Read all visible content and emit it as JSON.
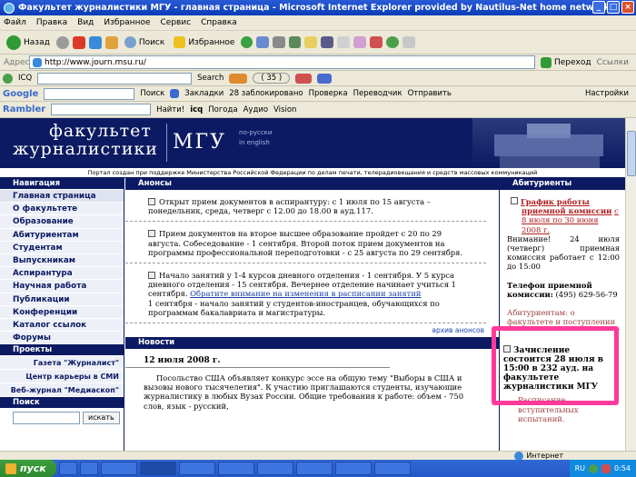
{
  "window": {
    "title": "Факультет журналистики МГУ - главная страница - Microsoft Internet Explorer provided by Nautilus-Net home network."
  },
  "menu": [
    "Файл",
    "Правка",
    "Вид",
    "Избранное",
    "Сервис",
    "Справка"
  ],
  "toolbar": {
    "back": "Назад",
    "search": "Поиск",
    "favorites": "Избранное"
  },
  "address": {
    "label": "Адрес",
    "url": "http://www.journ.msu.ru/",
    "go": "Переход",
    "links": "Ссылки"
  },
  "icq_bar": {
    "label": "ICQ",
    "search": "Search",
    "count": "( 35 )"
  },
  "google_bar": {
    "label": "Google",
    "search": "Поиск",
    "bookmarks": "Закладки",
    "blocked": "28 заблокировано",
    "check": "Проверка",
    "translate": "Переводчик",
    "send": "Отправить",
    "settings": "Настройки"
  },
  "rambler_bar": {
    "label": "Rambler",
    "find": "Найти!",
    "icq": "icq",
    "weather": "Погода",
    "audio": "Аудио",
    "vision": "Vision"
  },
  "site": {
    "logo_line1": "факультет",
    "logo_line2": "журналистики",
    "logo_msu": "МГУ",
    "lang_ru": "по-русски",
    "lang_en": "in english",
    "portal_note": "Портал создан при поддержке Министерства Российской Федерации по делам печати, телерадиовещания и средств массовых коммуникаций"
  },
  "nav": {
    "header": "Навигация",
    "items": [
      "Главная страница",
      "О факультете",
      "Образование",
      "Абитуриентам",
      "Студентам",
      "Выпускникам",
      "Аспирантура",
      "Научная работа",
      "Публикации",
      "Конференции",
      "Каталог ссылок",
      "Форумы"
    ],
    "projects_header": "Проекты",
    "projects": [
      "Газета \"Журналист\"",
      "Центр карьеры в СМИ",
      "Веб-журнал \"Медиаскоп\""
    ],
    "search_header": "Поиск",
    "search_button": "искать"
  },
  "announcements": {
    "header": "Анонсы",
    "items": [
      {
        "text": "Открыт прием документов в аспирантуру: с 1 июля по 15 августа – понедельник, среда, четверг с 12.00 до 18.00 в ауд.117."
      },
      {
        "text": "Прием документов на второе высшее образование пройдет с 20 по 29 августа. Собеседование - 1 сентября. Второй поток прием документов на программы профессиональной переподготовки - с 25 августа по 29 сентября."
      },
      {
        "text": "Начало занятий у 1-4 курсов дневного отделения - 1 сентября. У 5 курса дневного отделения - 15 сентября. Вечернее отделение начинает учиться 1 сентября.",
        "link": "Обратите внимание на изменения в расписании занятий",
        "tail": "1 сентября - начало занятий у студентов-иностранцев, обучающихся по программам бакалавриата и магистратуры."
      }
    ],
    "archive": "архив анонсов"
  },
  "news": {
    "header": "Новости",
    "date": "12 июля 2008 г.",
    "text": "Посольство США объявляет конкурс эссе на общую тему \"Выборы в США и вызовы нового тысячелетия\". К участию приглашаются студенты, изучающие журналистику в любых Вузах России. Общие требования к работе: объем - 750 слов, язык - русский,"
  },
  "applicants": {
    "header": "Абитуриенты",
    "schedule_link": "График работы приемной комиссии",
    "schedule_date": "с 8 июля по 30 июня 2008 г.",
    "notice": "Внимание! 24 июля (четверг) приемная комиссия работает с 12:00 до 15:00",
    "phone_label": "Телефон приемной комиссии:",
    "phone": "(495) 629-56-79",
    "more": "Абитуриентам: о факультете и поступлении",
    "enrollment": "Зачисление состоится 28 июля в 15:00 в 232 ауд. на факультете журналистики МГУ",
    "exams": "Расписание вступительных испытаний."
  },
  "status": {
    "zone": "Интернет"
  },
  "taskbar": {
    "start": "пуск",
    "lang": "RU",
    "time": "0:54"
  },
  "colors": {
    "nav_bg": "#0b1a62",
    "highlight": "#ff3a9a",
    "link": "#1a3fa8"
  }
}
